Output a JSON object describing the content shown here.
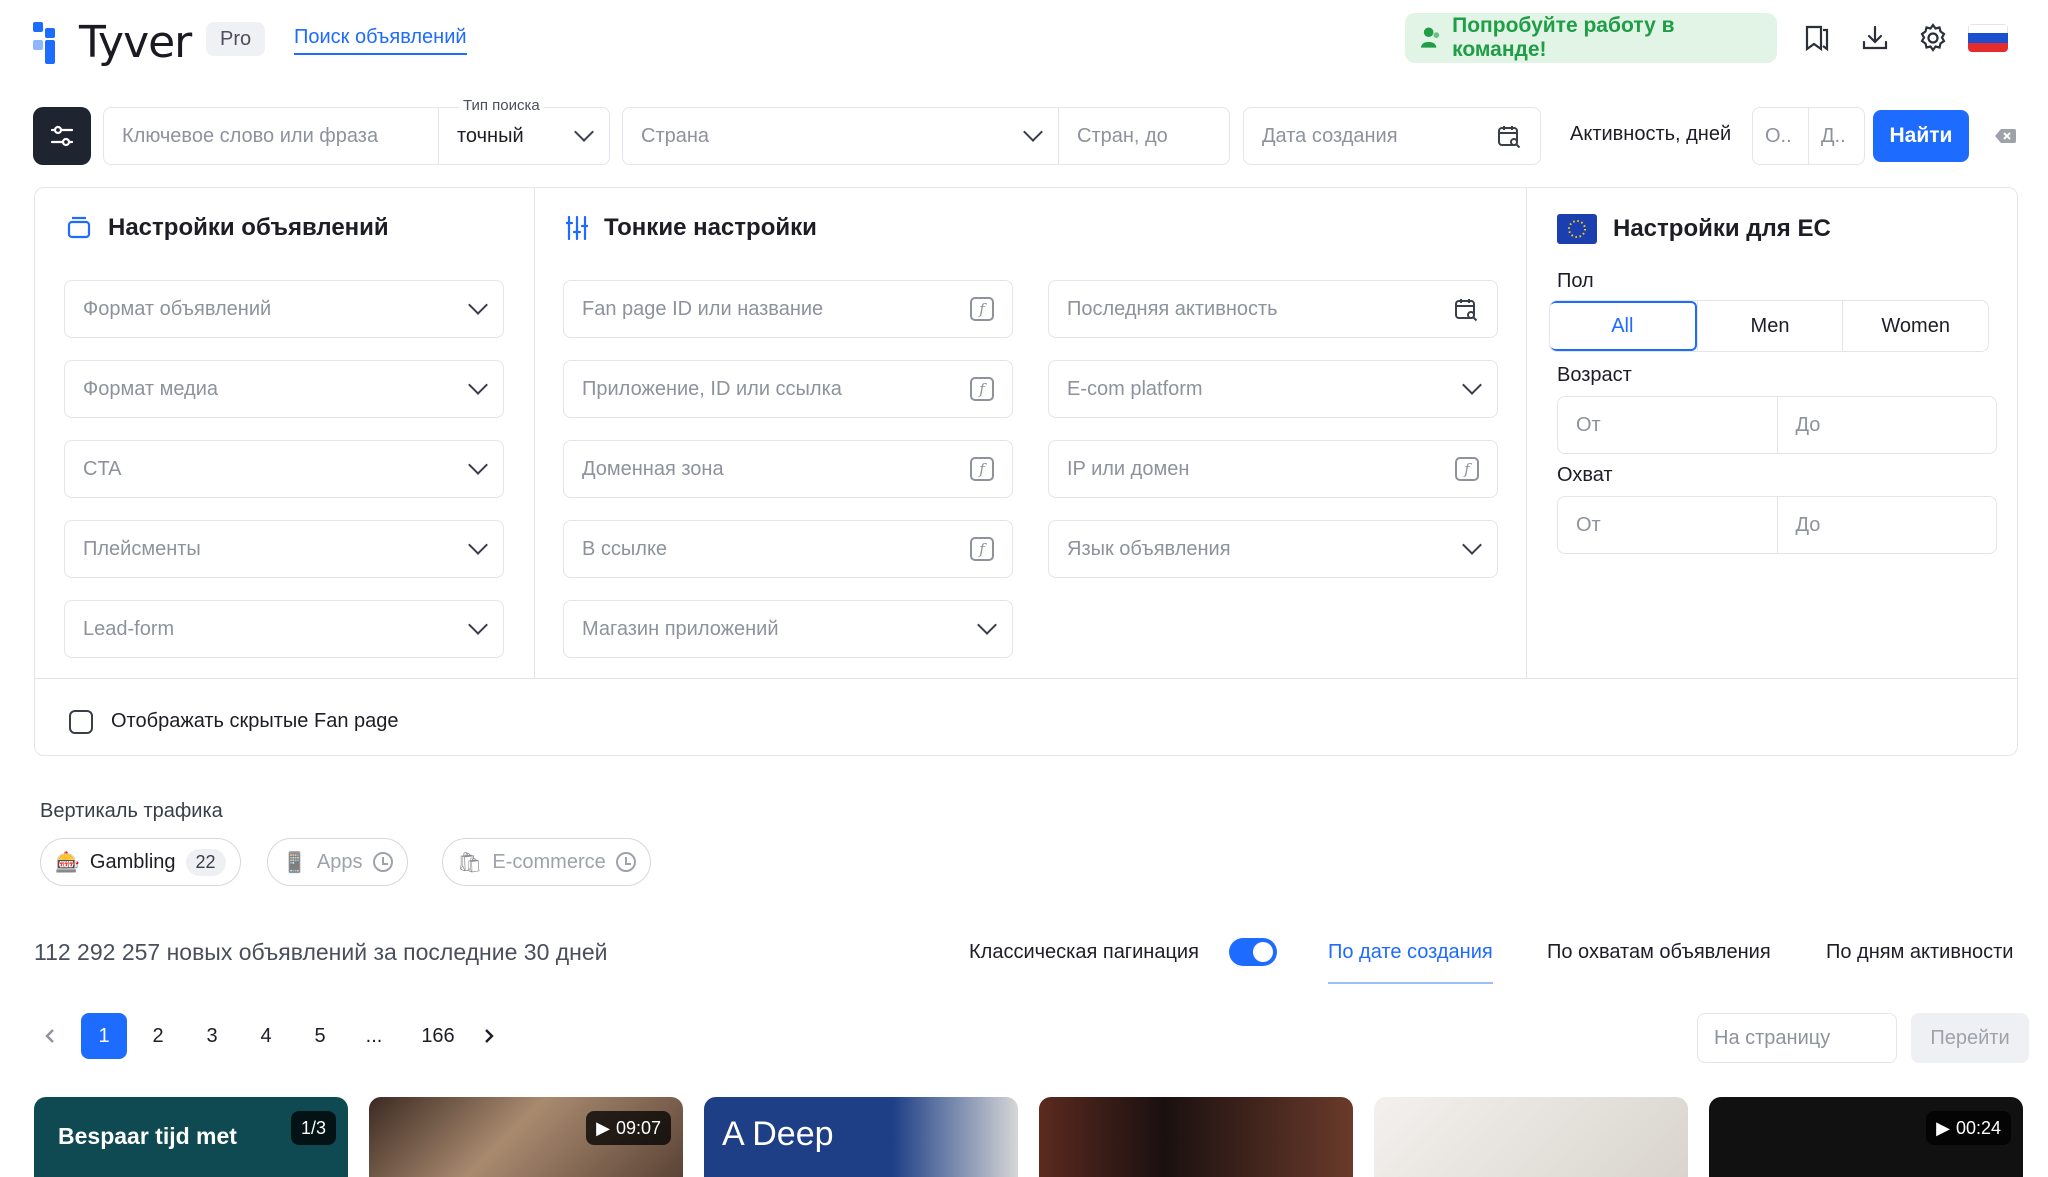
{
  "header": {
    "logo_text": "Tyver",
    "badge": "Pro",
    "nav_link": "Поиск объявлений",
    "team_cta": "Попробуйте работу в команде!"
  },
  "search": {
    "keyword_placeholder": "Ключевое слово или фраза",
    "search_type_label": "Тип поиска",
    "search_type_value": "точный",
    "country_placeholder": "Страна",
    "countries_to_placeholder": "Стран, до",
    "created_date_placeholder": "Дата создания",
    "activity_label": "Активность, дней",
    "activity_from_placeholder": "О..",
    "activity_to_placeholder": "Д..",
    "find_button": "Найти"
  },
  "ad_settings": {
    "title": "Настройки объявлений",
    "fields": [
      "Формат объявлений",
      "Формат медиа",
      "CTA",
      "Плейсменты",
      "Lead-form"
    ]
  },
  "fine_settings": {
    "title": "Тонкие настройки",
    "col1": [
      "Fan page ID или название",
      "Приложение, ID или ссылка",
      "Доменная зона",
      "В ссылке",
      "Магазин приложений"
    ],
    "col2": [
      "Последняя активность",
      "E-com platform",
      "IP или домен",
      "Язык объявления"
    ]
  },
  "eu_settings": {
    "title": "Настройки для ЕС",
    "gender_label": "Пол",
    "gender_options": [
      "All",
      "Men",
      "Women"
    ],
    "gender_selected": "All",
    "age_label": "Возраст",
    "reach_label": "Охват",
    "from_placeholder": "От",
    "to_placeholder": "До"
  },
  "hidden_fanpage_label": "Отображать скрытые Fan page",
  "verticals": {
    "label": "Вертикаль трафика",
    "items": [
      {
        "name": "Gambling",
        "count": "22"
      },
      {
        "name": "Apps"
      },
      {
        "name": "E-commerce"
      }
    ]
  },
  "results": {
    "summary": "112 292 257 новых объявлений за последние 30 дней",
    "classic_pagination_label": "Классическая пагинация",
    "classic_pagination_on": true,
    "sort_options": [
      "По дате создания",
      "По охватам объявления",
      "По дням активности"
    ],
    "sort_selected": "По дате создания"
  },
  "pagination": {
    "pages": [
      "1",
      "2",
      "3",
      "4",
      "5",
      "...",
      "166"
    ],
    "current": "1",
    "goto_placeholder": "На страницу",
    "goto_button": "Перейти"
  },
  "cards": [
    {
      "badge": "1/3",
      "text": "Bespaar tijd met",
      "color": "#0f4a52"
    },
    {
      "badge": "09:07",
      "color": "#7a5a43"
    },
    {
      "text": "A Deep",
      "color": "#1e3f86"
    },
    {
      "color": "#3a1f1a"
    },
    {
      "color": "#e9e6e2"
    },
    {
      "badge": "00:24",
      "color": "#111111"
    }
  ],
  "colors": {
    "accent": "#1e6bff",
    "team_green": "#1f9d47",
    "dark_button": "#1f2530"
  }
}
